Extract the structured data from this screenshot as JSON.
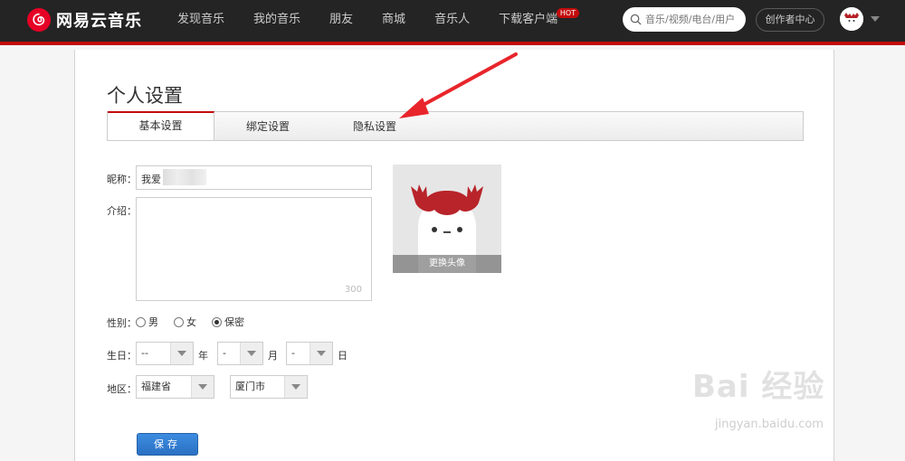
{
  "header": {
    "logo_text": "网易云音乐",
    "nav_items": [
      "发现音乐",
      "我的音乐",
      "朋友",
      "商城",
      "音乐人",
      "下载客户端"
    ],
    "hot_badge": "HOT",
    "search_placeholder": "音乐/视频/电台/用户",
    "creator_button": "创作者中心"
  },
  "page": {
    "title": "个人设置",
    "tabs": [
      "基本设置",
      "绑定设置",
      "隐私设置"
    ],
    "active_tab": "基本设置"
  },
  "form": {
    "nickname_label": "昵称：",
    "nickname_value": "我爱",
    "intro_label": "介绍：",
    "intro_count": "300",
    "gender_label": "性别：",
    "gender_options": [
      "男",
      "女",
      "保密"
    ],
    "gender_selected": "保密",
    "birthday_label": "生日：",
    "birthday_year": "--",
    "birthday_month": "-",
    "birthday_day": "-",
    "year_unit": "年",
    "month_unit": "月",
    "day_unit": "日",
    "region_label": "地区：",
    "province": "福建省",
    "city": "厦门市",
    "save_button": "保存"
  },
  "avatar": {
    "change_label": "更换头像"
  },
  "watermark": {
    "logo": "Bai 经验",
    "url": "jingyan.baidu.com"
  },
  "colors": {
    "brand_red": "#c20c0c",
    "topbar": "#242424",
    "save_blue": "#2a70c4",
    "annotation_red": "#e8252b"
  }
}
